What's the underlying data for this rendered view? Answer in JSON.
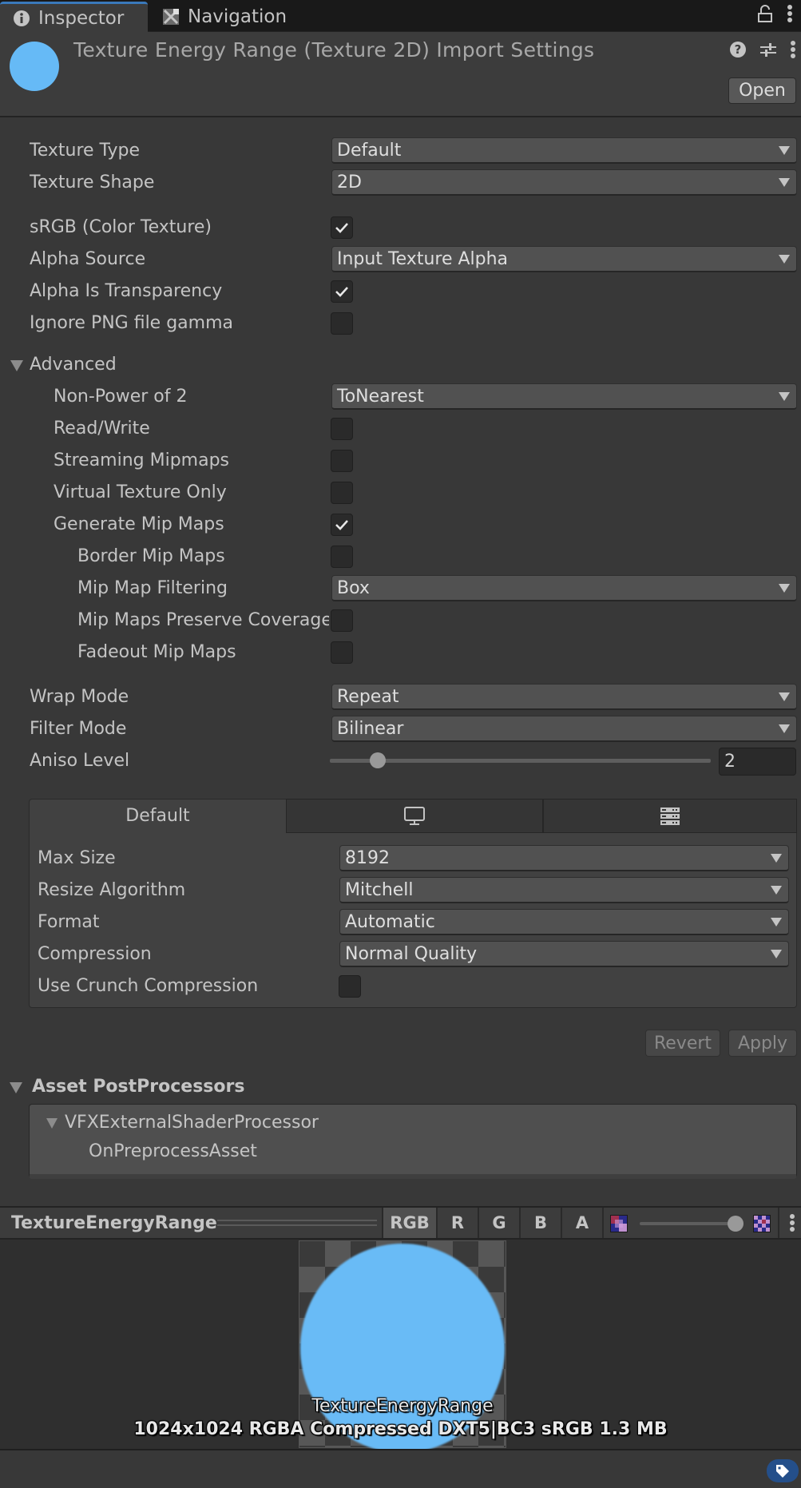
{
  "tabs": {
    "inspector": "Inspector",
    "navigation": "Navigation"
  },
  "header": {
    "title": "Texture Energy Range (Texture 2D) Import Settings",
    "open_button": "Open",
    "asset_color": "#66baf6"
  },
  "settings": {
    "texture_type": {
      "label": "Texture Type",
      "value": "Default"
    },
    "texture_shape": {
      "label": "Texture Shape",
      "value": "2D"
    },
    "srgb": {
      "label": "sRGB (Color Texture)",
      "checked": true
    },
    "alpha_source": {
      "label": "Alpha Source",
      "value": "Input Texture Alpha"
    },
    "alpha_is_transparency": {
      "label": "Alpha Is Transparency",
      "checked": true
    },
    "ignore_png_gamma": {
      "label": "Ignore PNG file gamma",
      "checked": false
    }
  },
  "advanced": {
    "label": "Advanced",
    "expanded": true,
    "non_power_of_2": {
      "label": "Non-Power of 2",
      "value": "ToNearest"
    },
    "read_write": {
      "label": "Read/Write",
      "checked": false
    },
    "streaming_mipmaps": {
      "label": "Streaming Mipmaps",
      "checked": false
    },
    "virtual_texture_only": {
      "label": "Virtual Texture Only",
      "checked": false
    },
    "generate_mip_maps": {
      "label": "Generate Mip Maps",
      "checked": true
    },
    "border_mip_maps": {
      "label": "Border Mip Maps",
      "checked": false
    },
    "mip_map_filtering": {
      "label": "Mip Map Filtering",
      "value": "Box"
    },
    "mip_maps_preserve_coverage": {
      "label": "Mip Maps Preserve Coverage",
      "checked": false
    },
    "fadeout_mip_maps": {
      "label": "Fadeout Mip Maps",
      "checked": false
    }
  },
  "sampling": {
    "wrap_mode": {
      "label": "Wrap Mode",
      "value": "Repeat"
    },
    "filter_mode": {
      "label": "Filter Mode",
      "value": "Bilinear"
    },
    "aniso_level": {
      "label": "Aniso Level",
      "value": "2",
      "min": 0,
      "max": 16
    }
  },
  "platform": {
    "tabs": [
      {
        "label": "Default",
        "icon": "default",
        "active": true
      },
      {
        "label": "",
        "icon": "monitor-icon",
        "active": false
      },
      {
        "label": "",
        "icon": "server-icon",
        "active": false
      }
    ],
    "max_size": {
      "label": "Max Size",
      "value": "8192"
    },
    "resize_algorithm": {
      "label": "Resize Algorithm",
      "value": "Mitchell"
    },
    "format": {
      "label": "Format",
      "value": "Automatic"
    },
    "compression": {
      "label": "Compression",
      "value": "Normal Quality"
    },
    "use_crunch": {
      "label": "Use Crunch Compression",
      "checked": false
    }
  },
  "actions": {
    "revert": "Revert",
    "apply": "Apply"
  },
  "postprocessors": {
    "label": "Asset PostProcessors",
    "processor": "VFXExternalShaderProcessor",
    "method": "OnPreprocessAsset"
  },
  "preview": {
    "name": "TextureEnergyRange",
    "channels": [
      "RGB",
      "R",
      "G",
      "B",
      "A"
    ],
    "active_channel": "RGB",
    "mip_level_fraction": 1.0,
    "overlay_name": "TextureEnergyRange",
    "overlay_info": "1024x1024  RGBA Compressed DXT5|BC3 sRGB   1.3 MB"
  }
}
